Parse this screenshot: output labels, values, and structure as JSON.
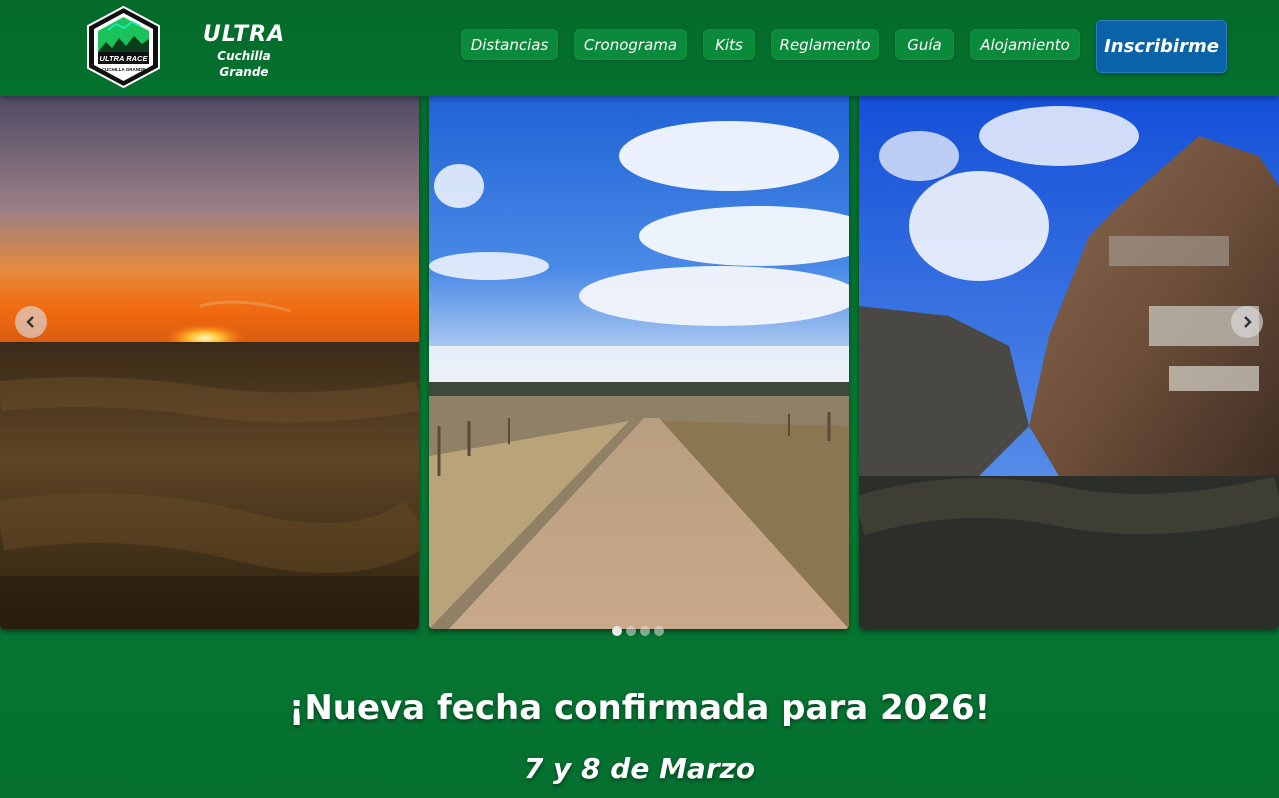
{
  "header": {
    "logo": {
      "alt_icon": "ultra-race-logo",
      "text_top": "ULTRA RACE",
      "text_bottom": "CUCHILLA GRANDE"
    },
    "brand_title": "ULTRA",
    "brand_subtitle": "Cuchilla Grande",
    "nav": [
      {
        "label": "Distancias"
      },
      {
        "label": "Cronograma"
      },
      {
        "label": "Kits"
      },
      {
        "label": "Reglamento"
      },
      {
        "label": "Guía"
      },
      {
        "label": "Alojamiento"
      }
    ],
    "cta_label": "Inscribirme"
  },
  "carousel": {
    "slides": [
      {
        "scene": "sunset-over-grassland"
      },
      {
        "scene": "gravel-road-blue-sky"
      },
      {
        "scene": "rock-outcrop-blue-sky"
      }
    ],
    "prev_icon": "chevron-left-icon",
    "next_icon": "chevron-right-icon",
    "dot_count": 4,
    "active_index": 0
  },
  "hero": {
    "headline": "¡Nueva fecha confirmada para 2026!",
    "date": "7 y 8 de Marzo"
  },
  "colors": {
    "brand_green": "#077a34",
    "nav_button_green": "#0a8a3a",
    "cta_blue": "#0a63a8"
  }
}
